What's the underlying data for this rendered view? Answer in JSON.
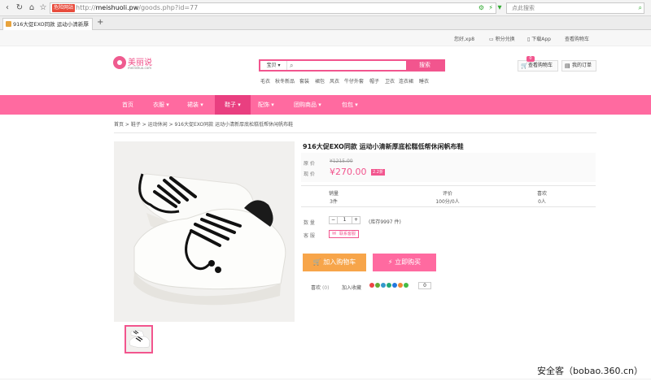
{
  "browser": {
    "address_tag": "危险网站",
    "url_prefix": "http://",
    "url_domain": "meishuoli.pw",
    "url_path": "/goods.php?id=77",
    "search_placeholder": "点此搜索",
    "tab_title": "916大促EXO同款 运动小清新厚",
    "new_tab": "+"
  },
  "topbar": {
    "user": "您好,xp8",
    "points": "积分兑换",
    "app": "下载App",
    "view_cart": "查看购物车"
  },
  "logo": {
    "name": "美丽说",
    "domain": "meilishuo.com"
  },
  "search": {
    "select_label": "宝贝",
    "button": "搜索",
    "hot_words": [
      "毛衣",
      "秋冬新品",
      "套装",
      "裙包",
      "风衣",
      "牛仔外套",
      "帽子",
      "卫衣",
      "连衣裙",
      "睡衣"
    ]
  },
  "cart": {
    "count": "0",
    "label": "查看购物车",
    "orders": "我的订单"
  },
  "nav": [
    "首页",
    "衣服",
    "裙装",
    "鞋子",
    "配饰",
    "团购商品",
    "包包"
  ],
  "breadcrumb": "首页 > 鞋子 > 运动休闲 > 916大促EXO同款 运动小清新厚底松糕低帮休闲帆布鞋",
  "product": {
    "title": "916大促EXO同款 运动小清新厚底松糕低帮休闲帆布鞋",
    "orig_label": "原 价",
    "orig_price": "¥1215.00",
    "price_label": "现 价",
    "price": "¥270.00",
    "discount": "2.2折",
    "stats": [
      {
        "label": "销量",
        "value": "3件"
      },
      {
        "label": "评价",
        "value": "100分/0人"
      },
      {
        "label": "喜欢",
        "value": "0人"
      }
    ],
    "qty_label": "数 量",
    "qty": "1",
    "stock": "(库存9997 件)",
    "service_label": "客 服",
    "service_btn": "联系客服",
    "add_cart": "加入购物车",
    "buy_now": "立即购买",
    "like": "喜欢",
    "like_count": "(0)",
    "share_label": "加入收藏",
    "share_count": "0"
  },
  "watermark": "安全客（bobao.360.cn）",
  "colors": {
    "brand": "#ff6aa0",
    "brand_dark": "#e93f80",
    "cart_btn": "#f7a54a"
  }
}
